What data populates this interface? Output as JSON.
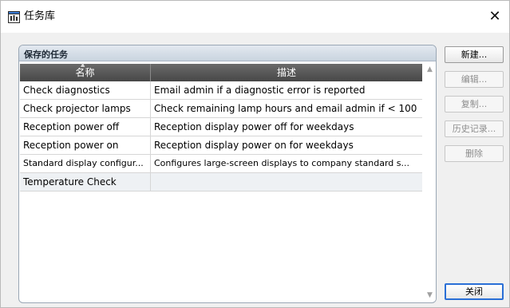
{
  "window": {
    "title": "任务库",
    "close_glyph": "✕"
  },
  "group": {
    "title": "保存的任务"
  },
  "table": {
    "columns": [
      "名称",
      "描述"
    ],
    "rows": [
      {
        "name": "Check diagnostics",
        "description": "Email admin if a diagnostic error is reported"
      },
      {
        "name": "Check projector lamps",
        "description": "Check remaining lamp hours and email admin if < 100"
      },
      {
        "name": "Reception power off",
        "description": "Reception display power off for weekdays"
      },
      {
        "name": "Reception power on",
        "description": "Reception display power on for weekdays"
      },
      {
        "name": "Standard display configur...",
        "description": "Configures large-screen displays to company standard s..."
      },
      {
        "name": "Temperature Check",
        "description": ""
      }
    ]
  },
  "buttons": {
    "new": "新建...",
    "edit": "编辑...",
    "copy": "复制...",
    "history": "历史记录...",
    "delete": "删除",
    "close": "关闭"
  },
  "icons": {
    "title": "task-library-icon",
    "close": "close-icon",
    "sort": "sort-up-icon",
    "scroll_up": "chevron-up-icon",
    "scroll_down": "chevron-down-icon"
  }
}
